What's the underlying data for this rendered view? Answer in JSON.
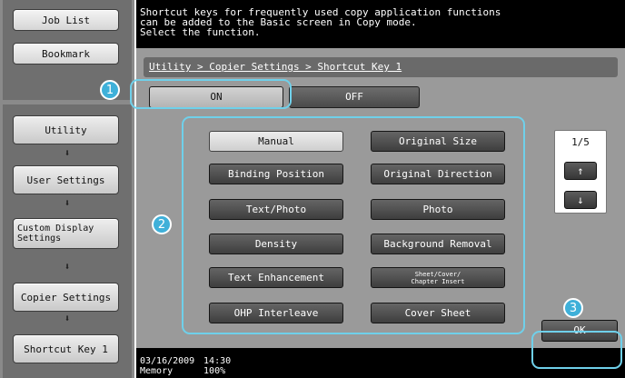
{
  "sidebar": {
    "job_list": "Job List",
    "bookmark": "Bookmark",
    "nav": [
      "Utility",
      "User Settings",
      "Custom Display\nSettings",
      "Copier Settings",
      "Shortcut Key 1"
    ],
    "arrow_glyph": "⬇"
  },
  "message": "Shortcut keys for frequently used copy application functions\ncan be added to the Basic screen in Copy mode.\nSelect the function.",
  "breadcrumb": "Utility > Copier Settings > Shortcut Key 1",
  "toggle": {
    "on": "ON",
    "off": "OFF",
    "selected": "ON"
  },
  "keys": [
    [
      "Manual",
      "Original Size"
    ],
    [
      "Binding Position",
      "Original Direction"
    ],
    [
      "Text/Photo",
      "Photo"
    ],
    [
      "Density",
      "Background Removal"
    ],
    [
      "Text Enhancement",
      "Sheet/Cover/\nChapter Insert"
    ],
    [
      "OHP Interleave",
      "Cover Sheet"
    ]
  ],
  "selected_key": "Manual",
  "pager": {
    "page": "1/5",
    "up_glyph": "↑",
    "down_glyph": "↓"
  },
  "ok": "OK",
  "footer": {
    "date": "03/16/2009",
    "time": "14:30",
    "memory_label": "Memory",
    "memory_value": "100%"
  },
  "callouts": [
    "1",
    "2",
    "3"
  ],
  "colors": {
    "callout": "#3fb0d9",
    "panel": "#9a9a9a",
    "black": "#000000"
  }
}
